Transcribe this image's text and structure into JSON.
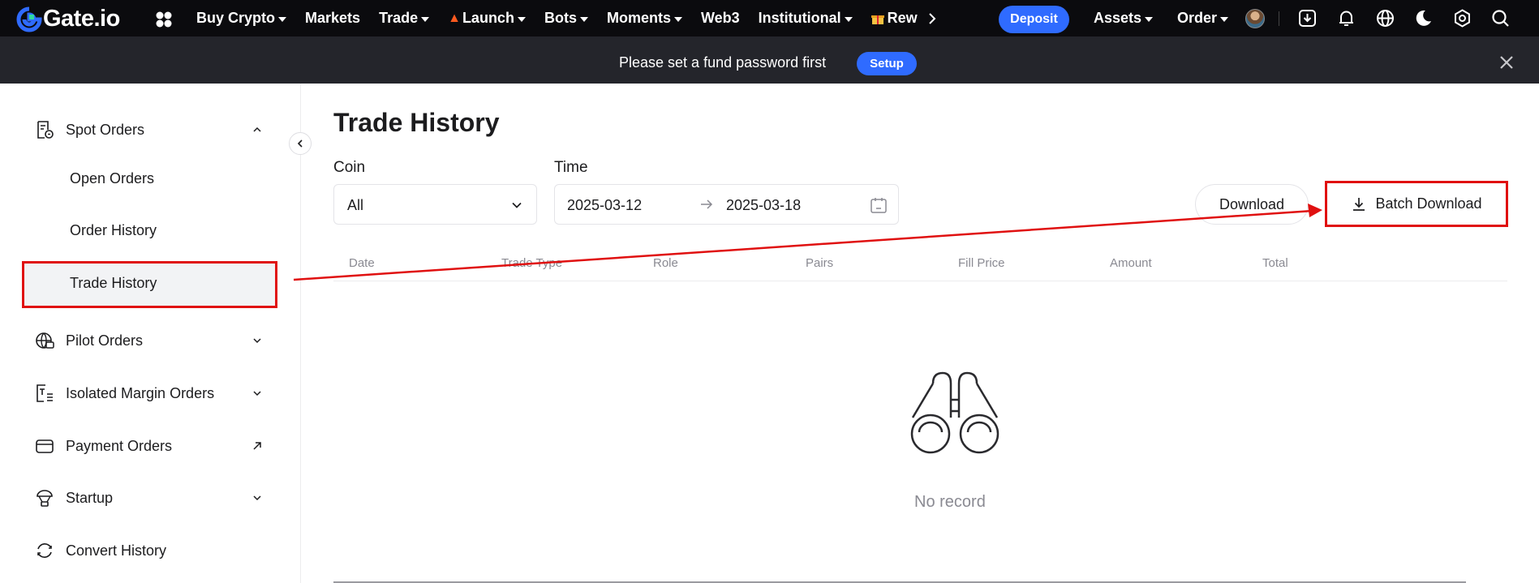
{
  "brand": {
    "name": "Gate.io"
  },
  "nav": {
    "items": [
      {
        "label": "Buy Crypto",
        "caret": true
      },
      {
        "label": "Markets",
        "caret": false
      },
      {
        "label": "Trade",
        "caret": true
      },
      {
        "label": "Launch",
        "caret": true
      },
      {
        "label": "Bots",
        "caret": true
      },
      {
        "label": "Moments",
        "caret": true
      },
      {
        "label": "Web3",
        "caret": false
      },
      {
        "label": "Institutional",
        "caret": true
      },
      {
        "label": "Rew",
        "caret": false
      }
    ],
    "deposit_label": "Deposit",
    "assets_label": "Assets",
    "order_label": "Order"
  },
  "banner": {
    "text": "Please set a fund password first",
    "setup_label": "Setup"
  },
  "sidebar": {
    "spot_orders": "Spot Orders",
    "open_orders": "Open Orders",
    "order_history": "Order History",
    "trade_history": "Trade History",
    "pilot_orders": "Pilot Orders",
    "isolated_margin_orders": "Isolated Margin Orders",
    "payment_orders": "Payment Orders",
    "startup": "Startup",
    "convert_history": "Convert History"
  },
  "main": {
    "title": "Trade History",
    "coin_label": "Coin",
    "coin_value": "All",
    "time_label": "Time",
    "date_start": "2025-03-12",
    "date_end": "2025-03-18",
    "download_label": "Download",
    "batch_download_label": "Batch Download",
    "columns": [
      "Date",
      "Trade Type",
      "Role",
      "Pairs",
      "Fill Price",
      "Amount",
      "Total"
    ],
    "empty_text": "No record"
  },
  "colors": {
    "accent": "#2f6bff",
    "annotation": "#e01010",
    "nav_bg": "#0b0b0e",
    "banner_bg": "#24252b"
  }
}
